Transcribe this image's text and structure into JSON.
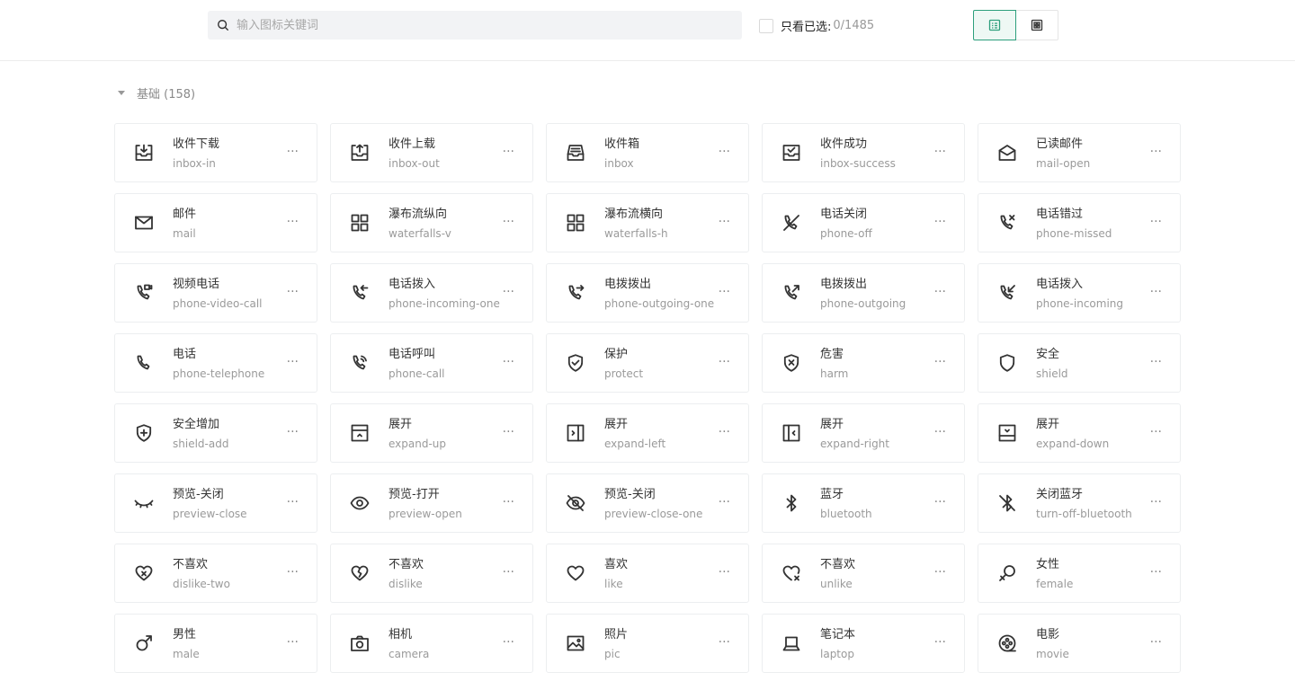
{
  "search": {
    "placeholder": "输入图标关键词"
  },
  "filter": {
    "label": "只看已选:",
    "count": "0/1485"
  },
  "view_toggle": [
    "list-view-icon",
    "grid-view-icon"
  ],
  "section": {
    "title": "基础 (158)"
  },
  "more_label": "···",
  "colors": {
    "accent": "#2d9f7c",
    "text": "#333333",
    "muted": "#9a9a9a"
  },
  "icons": [
    {
      "cn": "收件下载",
      "en": "inbox-in",
      "icon": "inbox-in-icon"
    },
    {
      "cn": "收件上载",
      "en": "inbox-out",
      "icon": "inbox-out-icon"
    },
    {
      "cn": "收件箱",
      "en": "inbox",
      "icon": "inbox-icon"
    },
    {
      "cn": "收件成功",
      "en": "inbox-success",
      "icon": "inbox-success-icon"
    },
    {
      "cn": "已读邮件",
      "en": "mail-open",
      "icon": "mail-open-icon"
    },
    {
      "cn": "邮件",
      "en": "mail",
      "icon": "mail-icon"
    },
    {
      "cn": "瀑布流纵向",
      "en": "waterfalls-v",
      "icon": "waterfalls-v-icon"
    },
    {
      "cn": "瀑布流横向",
      "en": "waterfalls-h",
      "icon": "waterfalls-h-icon"
    },
    {
      "cn": "电话关闭",
      "en": "phone-off",
      "icon": "phone-off-icon"
    },
    {
      "cn": "电话错过",
      "en": "phone-missed",
      "icon": "phone-missed-icon"
    },
    {
      "cn": "视频电话",
      "en": "phone-video-call",
      "icon": "phone-video-call-icon"
    },
    {
      "cn": "电话拨入",
      "en": "phone-incoming-one",
      "icon": "phone-incoming-one-icon"
    },
    {
      "cn": "电拨拨出",
      "en": "phone-outgoing-one",
      "icon": "phone-outgoing-one-icon"
    },
    {
      "cn": "电拨拨出",
      "en": "phone-outgoing",
      "icon": "phone-outgoing-icon"
    },
    {
      "cn": "电话拨入",
      "en": "phone-incoming",
      "icon": "phone-incoming-icon"
    },
    {
      "cn": "电话",
      "en": "phone-telephone",
      "icon": "phone-telephone-icon"
    },
    {
      "cn": "电话呼叫",
      "en": "phone-call",
      "icon": "phone-call-icon"
    },
    {
      "cn": "保护",
      "en": "protect",
      "icon": "protect-icon"
    },
    {
      "cn": "危害",
      "en": "harm",
      "icon": "harm-icon"
    },
    {
      "cn": "安全",
      "en": "shield",
      "icon": "shield-icon"
    },
    {
      "cn": "安全增加",
      "en": "shield-add",
      "icon": "shield-add-icon"
    },
    {
      "cn": "展开",
      "en": "expand-up",
      "icon": "expand-up-icon"
    },
    {
      "cn": "展开",
      "en": "expand-left",
      "icon": "expand-left-icon"
    },
    {
      "cn": "展开",
      "en": "expand-right",
      "icon": "expand-right-icon"
    },
    {
      "cn": "展开",
      "en": "expand-down",
      "icon": "expand-down-icon"
    },
    {
      "cn": "预览-关闭",
      "en": "preview-close",
      "icon": "preview-close-icon"
    },
    {
      "cn": "预览-打开",
      "en": "preview-open",
      "icon": "preview-open-icon"
    },
    {
      "cn": "预览-关闭",
      "en": "preview-close-one",
      "icon": "preview-close-one-icon"
    },
    {
      "cn": "蓝牙",
      "en": "bluetooth",
      "icon": "bluetooth-icon"
    },
    {
      "cn": "关闭蓝牙",
      "en": "turn-off-bluetooth",
      "icon": "turn-off-bluetooth-icon"
    },
    {
      "cn": "不喜欢",
      "en": "dislike-two",
      "icon": "dislike-two-icon"
    },
    {
      "cn": "不喜欢",
      "en": "dislike",
      "icon": "dislike-icon"
    },
    {
      "cn": "喜欢",
      "en": "like",
      "icon": "like-icon"
    },
    {
      "cn": "不喜欢",
      "en": "unlike",
      "icon": "unlike-icon"
    },
    {
      "cn": "女性",
      "en": "female",
      "icon": "female-icon"
    },
    {
      "cn": "男性",
      "en": "male",
      "icon": "male-icon"
    },
    {
      "cn": "相机",
      "en": "camera",
      "icon": "camera-icon"
    },
    {
      "cn": "照片",
      "en": "pic",
      "icon": "pic-icon"
    },
    {
      "cn": "笔记本",
      "en": "laptop",
      "icon": "laptop-icon"
    },
    {
      "cn": "电影",
      "en": "movie",
      "icon": "movie-icon"
    }
  ]
}
